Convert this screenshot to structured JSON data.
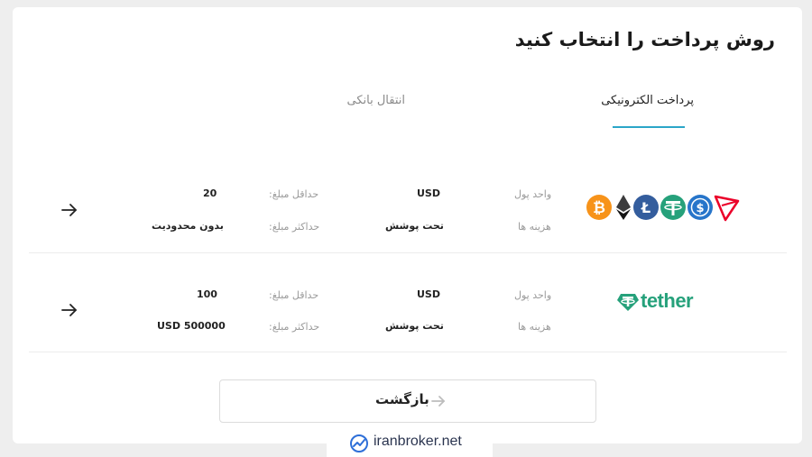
{
  "page": {
    "title": "روش پرداخت را انتخاب کنید"
  },
  "tabs": [
    {
      "label": "پرداخت الکترونیکی",
      "active": true
    },
    {
      "label": "انتقال بانکی",
      "active": false
    }
  ],
  "accent_color": "#2ba6c8",
  "methods": [
    {
      "icons": [
        "bitcoin-icon",
        "ethereum-icon",
        "litecoin-icon",
        "tether-icon",
        "usd-coin-icon",
        "tron-icon"
      ],
      "currency_label": "واحد پول",
      "currency_value": "USD",
      "fee_label": "هزینه ها",
      "fee_value": "تحت پوشش",
      "min_label": "حداقل مبلغ:",
      "min_value": "20",
      "max_label": "حداکثر مبلغ:",
      "max_value": "بدون محدودیت"
    },
    {
      "logo": "tether",
      "currency_label": "واحد پول",
      "currency_value": "USD",
      "fee_label": "هزینه ها",
      "fee_value": "تحت پوشش",
      "min_label": "حداقل مبلغ:",
      "min_value": "100",
      "max_label": "حداکثر مبلغ:",
      "max_value": "USD 500000"
    }
  ],
  "back_button": {
    "label": "بازگشت"
  },
  "watermark": {
    "text": "iranbroker.net"
  }
}
